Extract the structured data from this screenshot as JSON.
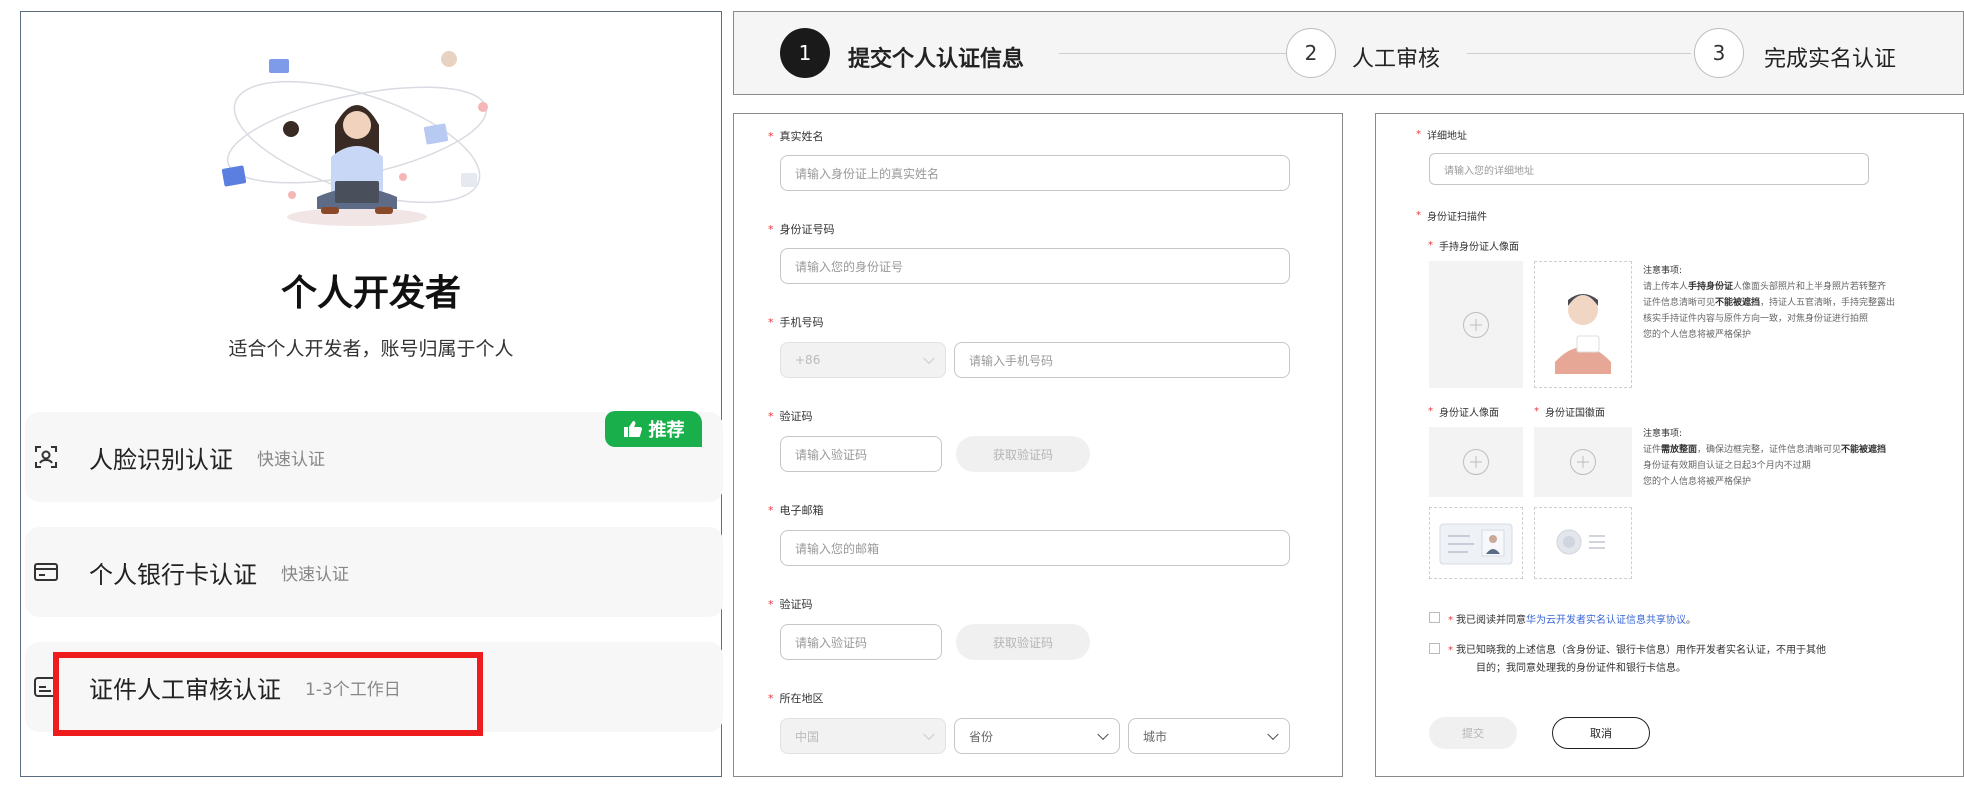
{
  "left": {
    "title": "个人开发者",
    "subtitle": "适合个人开发者，账号归属于个人",
    "badge": "推荐",
    "options": [
      {
        "title": "人脸识别认证",
        "sub": "快速认证"
      },
      {
        "title": "个人银行卡认证",
        "sub": "快速认证"
      },
      {
        "title": "证件人工审核认证",
        "sub": "1-3个工作日"
      }
    ]
  },
  "steps": [
    {
      "num": "1",
      "label": "提交个人认证信息"
    },
    {
      "num": "2",
      "label": "人工审核"
    },
    {
      "num": "3",
      "label": "完成实名认证"
    }
  ],
  "form": {
    "name_label": "真实姓名",
    "name_placeholder": "请输入身份证上的真实姓名",
    "id_label": "身份证号码",
    "id_placeholder": "请输入您的身份证号",
    "phone_label": "手机号码",
    "phone_prefix": "+86",
    "phone_placeholder": "请输入手机号码",
    "code_label": "验证码",
    "code_placeholder": "请输入验证码",
    "code_button": "获取验证码",
    "email_label": "电子邮箱",
    "email_placeholder": "请输入您的邮箱",
    "code2_label": "验证码",
    "code2_placeholder": "请输入验证码",
    "code2_button": "获取验证码",
    "region_label": "所在地区",
    "country": "中国",
    "province": "省份",
    "city": "城市"
  },
  "right": {
    "address_label": "详细地址",
    "address_placeholder": "请输入您的详细地址",
    "docs_label": "身份证扫描件",
    "handheld_label": "手持身份证人像面",
    "note1_title": "注意事项:",
    "note1_line1_pre": "请上传本人",
    "note1_line1_bold": "手持身份证",
    "note1_line1_post": "人像面头部照片和上半身照片若转整齐",
    "note1_line2_pre": "证件信息清晰可见",
    "note1_line2_bold": "不能被遮挡",
    "note1_line2_post": "，持证人五官清晰，手持完整露出",
    "note1_line3": "核实手持证件内容与原件方向一致，对焦身份证进行拍照",
    "note1_line4": "您的个人信息将被严格保护",
    "front_label": "身份证人像面",
    "back_label": "身份证国徽面",
    "note2_title": "注意事项:",
    "note2_line1_pre": "证件",
    "note2_line1_bold": "需放整面",
    "note2_line1_mid": "，确保边框完整，证件信息清晰可见",
    "note2_line1_bold2": "不能被遮挡",
    "note2_line2": "身份证有效期自认证之日起3个月内不过期",
    "note2_line3": "您的个人信息将被严格保护",
    "agree1_pre": "我已阅读并同意",
    "agree1_link": "华为云开发者实名认证信息共享协议",
    "agree1_post": "。",
    "agree2_line1": "我已知晓我的上述信息（含身份证、银行卡信息）用作开发者实名认证，不用于其他",
    "agree2_line2": "目的；我同意处理我的身份证件和银行卡信息。",
    "submit": "提交",
    "cancel": "取消"
  },
  "colors": {
    "badge": "#19b04b",
    "highlight": "#ee1c1c",
    "link": "#3a66d6",
    "required": "#e4393c"
  }
}
